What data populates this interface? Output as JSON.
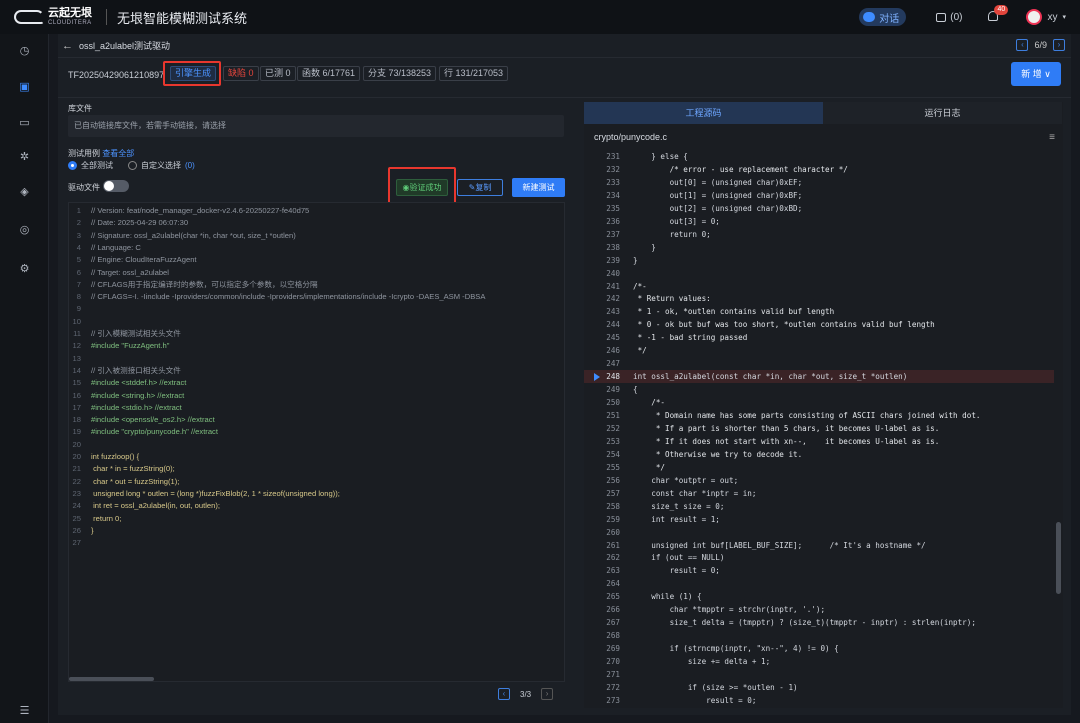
{
  "topbar": {
    "logo_cn": "云起无垠",
    "logo_en": "CLOUDITERA",
    "system_title": "无垠智能模糊测试系统",
    "chat_label": "对话",
    "tasks_label": "(0)",
    "notifications_badge": "40",
    "user_name": "xy"
  },
  "breadcrumb": {
    "back_glyph": "←",
    "title": "ossl_a2ulabel测试驱动",
    "page": "6/9",
    "prev_glyph": "‹",
    "next_glyph": "›"
  },
  "stats": {
    "task_id": "TF20250429061210897",
    "items": [
      {
        "label": "引擎生成",
        "style": "blue"
      },
      {
        "label": "缺陷 0",
        "style": "red"
      },
      {
        "label": "已测 0",
        "style": "normal"
      },
      {
        "label": "函数 6/17761",
        "style": "normal"
      },
      {
        "label": "分支 73/138253",
        "style": "normal"
      },
      {
        "label": "行 131/217053",
        "style": "normal"
      }
    ],
    "new_button": "新 增 ∨"
  },
  "left": {
    "lib_label": "库文件",
    "lib_placeholder": "已自动链接库文件，若需手动链接，请选择",
    "testcase_label": "测试用例",
    "view_all": "查看全部",
    "radio_all": "全部测试",
    "radio_custom": "自定义选择",
    "radio_custom_count": "(0)",
    "driver_label": "驱动文件",
    "verify_label": "验证成功",
    "copy_label": "复制",
    "newtest_label": "新建测试",
    "pager": "3/3",
    "pager_prev": "‹",
    "pager_next": "›",
    "code_lines": [
      {
        "n": "1",
        "t": "// Version: feat/node_manager_docker-v2.4.6-20250227-fe40d75",
        "k": "c"
      },
      {
        "n": "2",
        "t": "// Date: 2025-04-29 06:07:30",
        "k": "c"
      },
      {
        "n": "3",
        "t": "// Signature: ossl_a2ulabel(char *in, char *out, size_t *outlen)",
        "k": "c"
      },
      {
        "n": "4",
        "t": "// Language: C",
        "k": "c"
      },
      {
        "n": "5",
        "t": "// Engine: CloudIteraFuzzAgent",
        "k": "c"
      },
      {
        "n": "6",
        "t": "// Target: ossl_a2ulabel",
        "k": "c"
      },
      {
        "n": "7",
        "t": "// CFLAGS用于指定编译时的参数，可以指定多个参数，以空格分隔",
        "k": "c"
      },
      {
        "n": "8",
        "t": "// CFLAGS=-I. -Iinclude -Iproviders/common/include -Iproviders/implementations/include -Icrypto -DAES_ASM -DBSA",
        "k": "c"
      },
      {
        "n": "9",
        "t": "",
        "k": "c"
      },
      {
        "n": "10",
        "t": "",
        "k": "c"
      },
      {
        "n": "11",
        "t": "// 引入模糊测试相关头文件",
        "k": "c"
      },
      {
        "n": "12",
        "t": "#include \"FuzzAgent.h\"",
        "k": "i"
      },
      {
        "n": "13",
        "t": "",
        "k": "c"
      },
      {
        "n": "14",
        "t": "// 引入被测接口相关头文件",
        "k": "c"
      },
      {
        "n": "15",
        "t": "#include <stddef.h> //extract",
        "k": "i"
      },
      {
        "n": "16",
        "t": "#include <string.h> //extract",
        "k": "i"
      },
      {
        "n": "17",
        "t": "#include <stdio.h> //extract",
        "k": "i"
      },
      {
        "n": "18",
        "t": "#include <openssl/e_os2.h> //extract",
        "k": "i"
      },
      {
        "n": "19",
        "t": "#include \"crypto/punycode.h\" //extract",
        "k": "i"
      },
      {
        "n": "20",
        "t": "",
        "k": "c"
      },
      {
        "n": "20",
        "t": "int fuzzloop() {",
        "k": "f"
      },
      {
        "n": "21",
        "t": "    char * in = fuzzString(0);",
        "k": "f"
      },
      {
        "n": "22",
        "t": "    char * out = fuzzString(1);",
        "k": "f"
      },
      {
        "n": "23",
        "t": "    unsigned long * outlen = (long *)fuzzFixBlob(2, 1 * sizeof(unsigned long));",
        "k": "f"
      },
      {
        "n": "24",
        "t": "    int ret = ossl_a2ulabel(in, out, outlen);",
        "k": "f"
      },
      {
        "n": "25",
        "t": "    return 0;",
        "k": "f"
      },
      {
        "n": "26",
        "t": "}",
        "k": "f"
      },
      {
        "n": "27",
        "t": "",
        "k": "f"
      }
    ]
  },
  "right": {
    "tab_source": "工程源码",
    "tab_log": "运行日志",
    "file_name": "crypto/punycode.c",
    "menu_glyph": "≡",
    "highlight_line": "248",
    "code_lines": [
      {
        "n": "231",
        "t": "    } else {"
      },
      {
        "n": "232",
        "t": "        /* error - use replacement character */"
      },
      {
        "n": "233",
        "t": "        out[0] = (unsigned char)0xEF;"
      },
      {
        "n": "234",
        "t": "        out[1] = (unsigned char)0xBF;"
      },
      {
        "n": "235",
        "t": "        out[2] = (unsigned char)0xBD;"
      },
      {
        "n": "236",
        "t": "        out[3] = 0;"
      },
      {
        "n": "237",
        "t": "        return 0;"
      },
      {
        "n": "238",
        "t": "    }"
      },
      {
        "n": "239",
        "t": "}"
      },
      {
        "n": "240",
        "t": ""
      },
      {
        "n": "241",
        "t": "/*-"
      },
      {
        "n": "242",
        "t": " * Return values:"
      },
      {
        "n": "243",
        "t": " * 1 - ok, *outlen contains valid buf length"
      },
      {
        "n": "244",
        "t": " * 0 - ok but buf was too short, *outlen contains valid buf length"
      },
      {
        "n": "245",
        "t": " * -1 - bad string passed"
      },
      {
        "n": "246",
        "t": " */"
      },
      {
        "n": "247",
        "t": ""
      },
      {
        "n": "248",
        "t": "int ossl_a2ulabel(const char *in, char *out, size_t *outlen)"
      },
      {
        "n": "249",
        "t": "{"
      },
      {
        "n": "250",
        "t": "    /*-"
      },
      {
        "n": "251",
        "t": "     * Domain name has some parts consisting of ASCII chars joined with dot."
      },
      {
        "n": "252",
        "t": "     * If a part is shorter than 5 chars, it becomes U-label as is."
      },
      {
        "n": "253",
        "t": "     * If it does not start with xn--,    it becomes U-label as is."
      },
      {
        "n": "254",
        "t": "     * Otherwise we try to decode it."
      },
      {
        "n": "255",
        "t": "     */"
      },
      {
        "n": "256",
        "t": "    char *outptr = out;"
      },
      {
        "n": "257",
        "t": "    const char *inptr = in;"
      },
      {
        "n": "258",
        "t": "    size_t size = 0;"
      },
      {
        "n": "259",
        "t": "    int result = 1;"
      },
      {
        "n": "260",
        "t": ""
      },
      {
        "n": "261",
        "t": "    unsigned int buf[LABEL_BUF_SIZE];      /* It's a hostname */"
      },
      {
        "n": "262",
        "t": "    if (out == NULL)"
      },
      {
        "n": "263",
        "t": "        result = 0;"
      },
      {
        "n": "264",
        "t": ""
      },
      {
        "n": "265",
        "t": "    while (1) {"
      },
      {
        "n": "266",
        "t": "        char *tmpptr = strchr(inptr, '.');"
      },
      {
        "n": "267",
        "t": "        size_t delta = (tmpptr) ? (size_t)(tmpptr - inptr) : strlen(inptr);"
      },
      {
        "n": "268",
        "t": ""
      },
      {
        "n": "269",
        "t": "        if (strncmp(inptr, \"xn--\", 4) != 0) {"
      },
      {
        "n": "270",
        "t": "            size += delta + 1;"
      },
      {
        "n": "271",
        "t": ""
      },
      {
        "n": "272",
        "t": "            if (size >= *outlen - 1)"
      },
      {
        "n": "273",
        "t": "                result = 0;"
      }
    ]
  },
  "sidebar": {
    "icons": [
      "clock-icon",
      "box-icon",
      "folder-icon",
      "bug-icon",
      "layers-icon",
      "target-icon",
      "settings-icon",
      "menu-icon"
    ]
  },
  "colors": {
    "accent": "#2f7cf6",
    "highlight_box": "#e8372e",
    "success": "#5ecb78"
  }
}
